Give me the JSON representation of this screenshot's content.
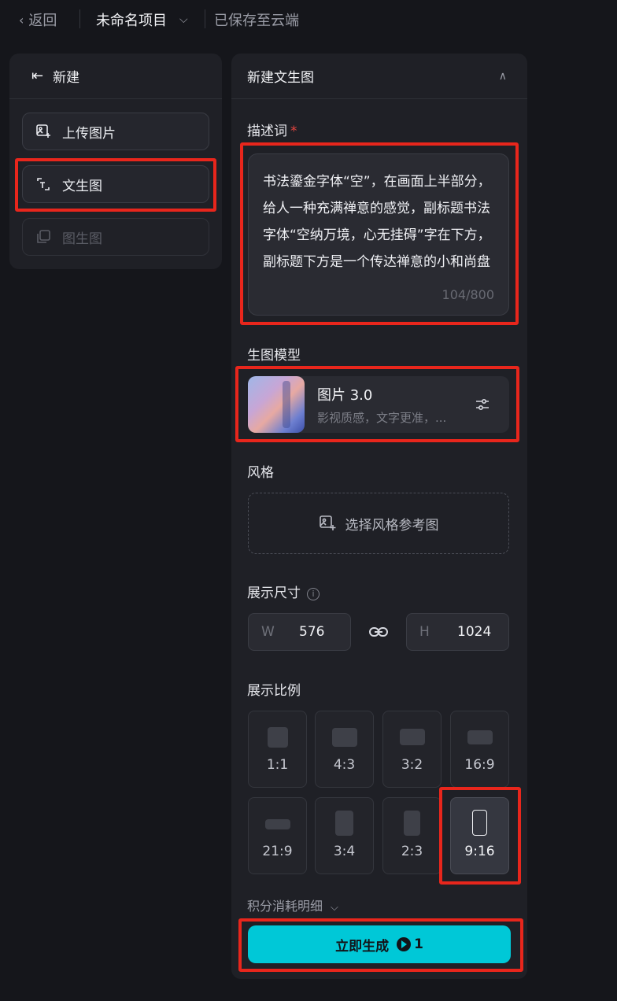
{
  "topbar": {
    "back_label": "返回",
    "project_name": "未命名项目",
    "save_status": "已保存至云端"
  },
  "left_panel": {
    "title": "新建",
    "items": [
      {
        "label": "上传图片",
        "state": "normal"
      },
      {
        "label": "文生图",
        "state": "selected"
      },
      {
        "label": "图生图",
        "state": "disabled"
      }
    ]
  },
  "right_panel": {
    "title": "新建文生图",
    "prompt": {
      "label": "描述词",
      "required_mark": "*",
      "value": "书法鎏金字体“空”，在画面上半部分，给人一种充满禅意的感觉，副标题书法字体“空纳万境，心无挂碍”字在下方，副标题下方是一个传达禅意的小和尚盘坐在石板上，黑色背",
      "counter": "104/800"
    },
    "model": {
      "label": "生图模型",
      "name": "图片 3.0",
      "description": "影视质感，文字更准，..."
    },
    "style": {
      "label": "风格",
      "button_label": "选择风格参考图"
    },
    "size": {
      "label": "展示尺寸",
      "width_label": "W",
      "width_value": "576",
      "height_label": "H",
      "height_value": "1024"
    },
    "ratio": {
      "label": "展示比例",
      "options": [
        "1:1",
        "4:3",
        "3:2",
        "16:9",
        "21:9",
        "3:4",
        "2:3",
        "9:16"
      ],
      "selected": "9:16"
    },
    "credits_label": "积分消耗明细",
    "generate": {
      "label": "立即生成",
      "cost": "1"
    }
  },
  "colors": {
    "background": "#15161b",
    "panel": "#1f2026",
    "accent": "#00c8d7",
    "highlight": "#e8261c",
    "required": "#e6453f"
  }
}
